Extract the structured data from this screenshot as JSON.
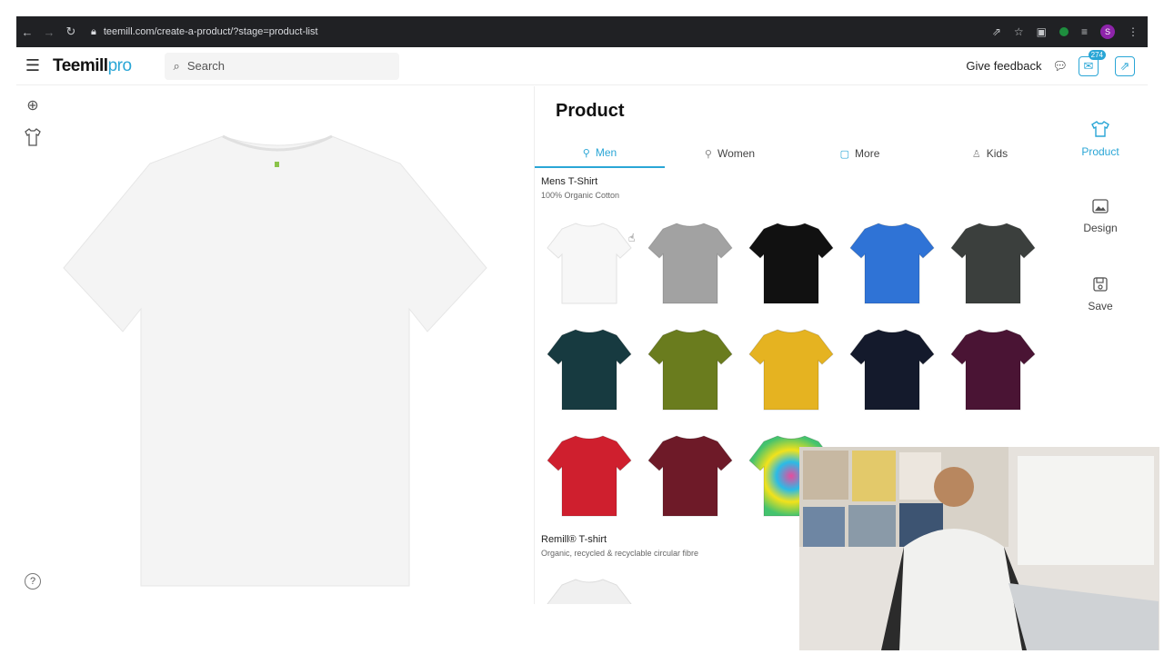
{
  "browser": {
    "url": "teemill.com/create-a-product/?stage=product-list",
    "avatar_initial": "S"
  },
  "header": {
    "logo_main": "Teemill",
    "logo_suffix": "pro",
    "search_placeholder": "Search",
    "feedback_label": "Give feedback",
    "mail_badge": "274"
  },
  "panel": {
    "title": "Product",
    "tabs": [
      {
        "label": "Men",
        "active": true
      },
      {
        "label": "Women",
        "active": false
      },
      {
        "label": "More",
        "active": false
      },
      {
        "label": "Kids",
        "active": false
      }
    ],
    "sections": [
      {
        "title": "Mens T-Shirt",
        "subtitle": "100% Organic Cotton",
        "colors": [
          "#f7f7f7",
          "#a2a2a2",
          "#111111",
          "#2f73d6",
          "#3b3f3d",
          "#173a40",
          "#6a7c1e",
          "#e5b321",
          "#141a2c",
          "#4a1434",
          "#cf1f2e",
          "#6e1a28",
          "tie-dye"
        ]
      },
      {
        "title": "Remill® T-shirt",
        "subtitle": "Organic, recycled & recyclable circular fibre"
      }
    ]
  },
  "sidenav": {
    "items": [
      {
        "label": "Product",
        "icon": "tshirt-icon",
        "active": true
      },
      {
        "label": "Design",
        "icon": "image-icon",
        "active": false
      },
      {
        "label": "Save",
        "icon": "save-icon",
        "active": false
      }
    ]
  },
  "accent": "#2aa6d6"
}
